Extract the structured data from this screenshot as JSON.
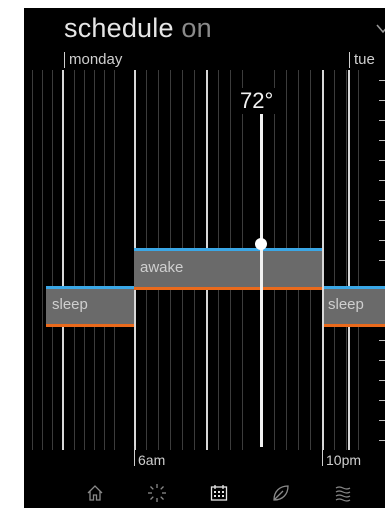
{
  "header": {
    "title": "schedule",
    "mode": "on"
  },
  "days": {
    "current": "monday",
    "next": "tue"
  },
  "setpoint": {
    "value": "72°"
  },
  "periods": [
    {
      "label": "sleep"
    },
    {
      "label": "awake"
    },
    {
      "label": "sleep"
    }
  ],
  "times": {
    "start": "6am",
    "end": "10pm"
  },
  "nav": [
    {
      "icon": "home-icon"
    },
    {
      "icon": "sun-icon"
    },
    {
      "icon": "calendar-icon"
    },
    {
      "icon": "leaf-icon"
    },
    {
      "icon": "heat-waves-icon"
    }
  ],
  "colors": {
    "heat_setpoint": "#ea6a1c",
    "cool_setpoint": "#3aa7e6",
    "band": "#6a6a6a"
  }
}
